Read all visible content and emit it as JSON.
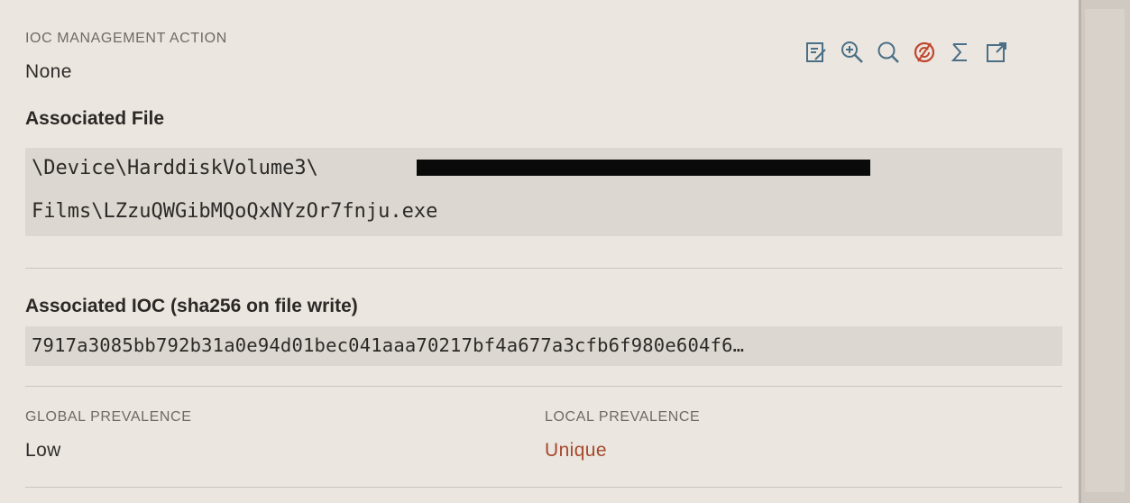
{
  "ioc_management": {
    "label": "IOC MANAGEMENT ACTION",
    "value": "None"
  },
  "toolbar": {
    "icons": [
      "edit-note-icon",
      "zoom-in-icon",
      "search-icon",
      "sync-icon",
      "sigma-icon",
      "export-icon"
    ]
  },
  "associated_file": {
    "title": "Associated File",
    "path_line1": "\\Device\\HarddiskVolume3\\",
    "path_line2": "Films\\LZzuQWGibMQoQxNYzOr7fnju.exe"
  },
  "associated_ioc": {
    "title": "Associated IOC (sha256 on file write)",
    "hash": "7917a3085bb792b31a0e94d01bec041aaa70217bf4a677a3cfb6f980e604f6…"
  },
  "prevalence": {
    "global_label": "GLOBAL PREVALENCE",
    "global_value": "Low",
    "local_label": "LOCAL PREVALENCE",
    "local_value": "Unique"
  },
  "colors": {
    "unique_value": "#a6492e",
    "accent_icon": "#c0452e",
    "icon": "#4a6f86"
  }
}
